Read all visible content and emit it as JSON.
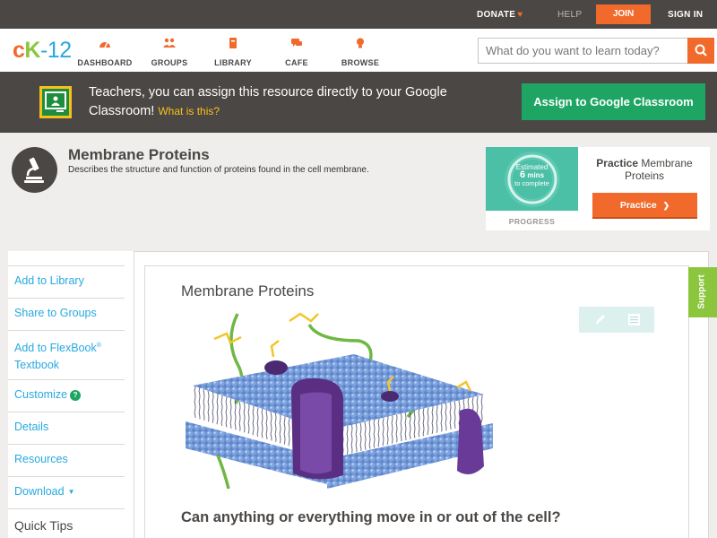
{
  "topbar": {
    "donate": "DONATE",
    "help": "HELP",
    "join": "JOIN",
    "signin": "SIGN IN"
  },
  "logo": {
    "c": "c",
    "k": "K",
    "n": "-12"
  },
  "nav": [
    {
      "label": "DASHBOARD",
      "icon": "dashboard-icon"
    },
    {
      "label": "GROUPS",
      "icon": "groups-icon"
    },
    {
      "label": "LIBRARY",
      "icon": "library-icon"
    },
    {
      "label": "CAFE",
      "icon": "cafe-icon"
    },
    {
      "label": "BROWSE",
      "icon": "browse-icon"
    }
  ],
  "search": {
    "placeholder": "What do you want to learn today?"
  },
  "banner": {
    "text": "Teachers, you can assign this resource directly to your Google Classroom!",
    "what": "What is this?",
    "assign": "Assign to Google Classroom"
  },
  "header": {
    "title": "Membrane Proteins",
    "description": "Describes the structure and function of proteins found in the cell membrane."
  },
  "practice": {
    "estimated": "Estimated",
    "mins_value": "6",
    "mins_unit": "mins",
    "to_complete": "to complete",
    "progress": "PROGRESS",
    "title_bold": "Practice",
    "title_rest": "Membrane Proteins",
    "button": "Practice"
  },
  "sidebar": {
    "add_library": "Add to Library",
    "share_groups": "Share to Groups",
    "add_flexbook_1": "Add to FlexBook",
    "add_flexbook_reg": "®",
    "add_flexbook_2": "Textbook",
    "customize": "Customize",
    "customize_badge": "?",
    "details": "Details",
    "resources": "Resources",
    "download": "Download",
    "download_caret": "▼",
    "quick_tips": "Quick Tips"
  },
  "lesson": {
    "title": "Membrane Proteins",
    "question": "Can anything or everything move in or out of the cell?"
  },
  "support": "Support",
  "colors": {
    "accent": "#f16a2c",
    "green": "#1ea563",
    "link": "#28a9e0",
    "dark": "#4a4744",
    "support": "#8cc63e"
  }
}
